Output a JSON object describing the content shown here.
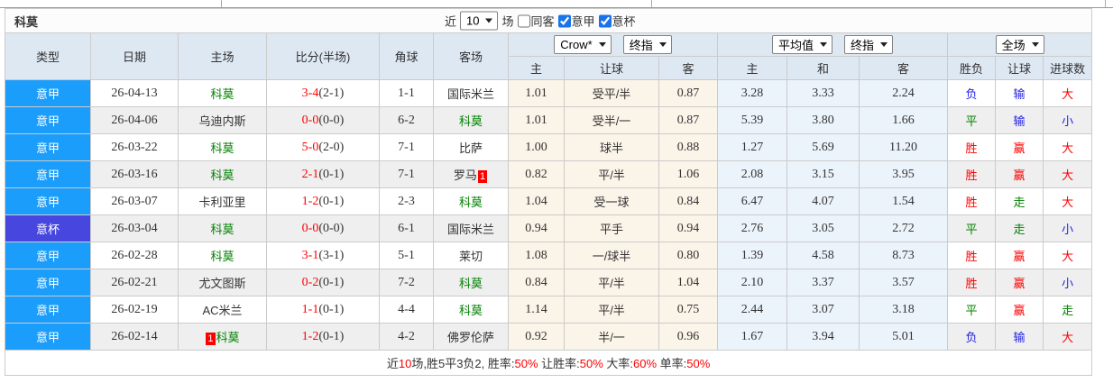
{
  "top": {
    "title": "科莫",
    "near_label": "近",
    "near_value": "10",
    "unit_label": "场",
    "checkboxes": [
      {
        "label": "同客",
        "checked": false
      },
      {
        "label": "意甲",
        "checked": true
      },
      {
        "label": "意杯",
        "checked": true
      }
    ]
  },
  "header": {
    "static": [
      "类型",
      "日期",
      "主场",
      "比分(半场)",
      "角球",
      "客场"
    ],
    "groups": [
      {
        "selects": [
          "Crow*",
          "终指"
        ],
        "sub": [
          "主",
          "让球",
          "客"
        ]
      },
      {
        "selects": [
          "平均值",
          "终指"
        ],
        "sub": [
          "主",
          "和",
          "客"
        ]
      },
      {
        "selects": [
          "全场"
        ],
        "sub": [
          "胜负",
          "让球",
          "进球数"
        ]
      }
    ]
  },
  "colors": {
    "serie_a_bg": "#1b9dfb",
    "coppa_bg": "#4747e0",
    "win_red": "#ff0000",
    "draw_green": "#008000",
    "lose_blue": "#2323e5",
    "como_green": "#008000"
  },
  "rows": [
    {
      "league": "意甲",
      "league_key": "seriea",
      "date": "26-04-13",
      "home": {
        "name": "科莫",
        "self": true
      },
      "score": "3-4",
      "half": "(2-1)",
      "corner": "1-1",
      "away": {
        "name": "国际米兰",
        "self": false
      },
      "crow": {
        "home": "1.01",
        "handicap": "受平/半",
        "away": "0.87"
      },
      "avg": {
        "home": "3.28",
        "draw": "3.33",
        "away": "2.24"
      },
      "full": {
        "wdl": {
          "t": "负",
          "c": "b"
        },
        "handicap": {
          "t": "输",
          "c": "b"
        },
        "goals": {
          "t": "大",
          "c": "r"
        }
      }
    },
    {
      "league": "意甲",
      "league_key": "seriea",
      "date": "26-04-06",
      "home": {
        "name": "乌迪内斯",
        "self": false
      },
      "score": "0-0",
      "half": "(0-0)",
      "corner": "6-2",
      "away": {
        "name": "科莫",
        "self": true
      },
      "crow": {
        "home": "1.01",
        "handicap": "受半/一",
        "away": "0.87"
      },
      "avg": {
        "home": "5.39",
        "draw": "3.80",
        "away": "1.66"
      },
      "full": {
        "wdl": {
          "t": "平",
          "c": "g"
        },
        "handicap": {
          "t": "输",
          "c": "b"
        },
        "goals": {
          "t": "小",
          "c": "b"
        }
      }
    },
    {
      "league": "意甲",
      "league_key": "seriea",
      "date": "26-03-22",
      "home": {
        "name": "科莫",
        "self": true
      },
      "score": "5-0",
      "half": "(2-0)",
      "corner": "7-1",
      "away": {
        "name": "比萨",
        "self": false
      },
      "crow": {
        "home": "1.00",
        "handicap": "球半",
        "away": "0.88"
      },
      "avg": {
        "home": "1.27",
        "draw": "5.69",
        "away": "11.20"
      },
      "full": {
        "wdl": {
          "t": "胜",
          "c": "r"
        },
        "handicap": {
          "t": "赢",
          "c": "r"
        },
        "goals": {
          "t": "大",
          "c": "r"
        }
      }
    },
    {
      "league": "意甲",
      "league_key": "seriea",
      "date": "26-03-16",
      "home": {
        "name": "科莫",
        "self": true
      },
      "score": "2-1",
      "half": "(0-1)",
      "corner": "7-1",
      "away": {
        "name": "罗马",
        "self": false,
        "badge": "1",
        "badge_pos": "after"
      },
      "crow": {
        "home": "0.82",
        "handicap": "平/半",
        "away": "1.06"
      },
      "avg": {
        "home": "2.08",
        "draw": "3.15",
        "away": "3.95"
      },
      "full": {
        "wdl": {
          "t": "胜",
          "c": "r"
        },
        "handicap": {
          "t": "赢",
          "c": "r"
        },
        "goals": {
          "t": "大",
          "c": "r"
        }
      }
    },
    {
      "league": "意甲",
      "league_key": "seriea",
      "date": "26-03-07",
      "home": {
        "name": "卡利亚里",
        "self": false
      },
      "score": "1-2",
      "half": "(0-1)",
      "corner": "2-3",
      "away": {
        "name": "科莫",
        "self": true
      },
      "crow": {
        "home": "1.04",
        "handicap": "受一球",
        "away": "0.84"
      },
      "avg": {
        "home": "6.47",
        "draw": "4.07",
        "away": "1.54"
      },
      "full": {
        "wdl": {
          "t": "胜",
          "c": "r"
        },
        "handicap": {
          "t": "走",
          "c": "g"
        },
        "goals": {
          "t": "大",
          "c": "r"
        }
      }
    },
    {
      "league": "意杯",
      "league_key": "coppa",
      "date": "26-03-04",
      "home": {
        "name": "科莫",
        "self": true
      },
      "score": "0-0",
      "half": "(0-0)",
      "corner": "6-1",
      "away": {
        "name": "国际米兰",
        "self": false
      },
      "crow": {
        "home": "0.94",
        "handicap": "平手",
        "away": "0.94"
      },
      "avg": {
        "home": "2.76",
        "draw": "3.05",
        "away": "2.72"
      },
      "full": {
        "wdl": {
          "t": "平",
          "c": "g"
        },
        "handicap": {
          "t": "走",
          "c": "g"
        },
        "goals": {
          "t": "小",
          "c": "b"
        }
      }
    },
    {
      "league": "意甲",
      "league_key": "seriea",
      "date": "26-02-28",
      "home": {
        "name": "科莫",
        "self": true
      },
      "score": "3-1",
      "half": "(3-1)",
      "corner": "5-1",
      "away": {
        "name": "莱切",
        "self": false
      },
      "crow": {
        "home": "1.08",
        "handicap": "一/球半",
        "away": "0.80"
      },
      "avg": {
        "home": "1.39",
        "draw": "4.58",
        "away": "8.73"
      },
      "full": {
        "wdl": {
          "t": "胜",
          "c": "r"
        },
        "handicap": {
          "t": "赢",
          "c": "r"
        },
        "goals": {
          "t": "大",
          "c": "r"
        }
      }
    },
    {
      "league": "意甲",
      "league_key": "seriea",
      "date": "26-02-21",
      "home": {
        "name": "尤文图斯",
        "self": false
      },
      "score": "0-2",
      "half": "(0-1)",
      "corner": "7-2",
      "away": {
        "name": "科莫",
        "self": true
      },
      "crow": {
        "home": "0.84",
        "handicap": "平/半",
        "away": "1.04"
      },
      "avg": {
        "home": "2.10",
        "draw": "3.37",
        "away": "3.57"
      },
      "full": {
        "wdl": {
          "t": "胜",
          "c": "r"
        },
        "handicap": {
          "t": "赢",
          "c": "r"
        },
        "goals": {
          "t": "小",
          "c": "b"
        }
      }
    },
    {
      "league": "意甲",
      "league_key": "seriea",
      "date": "26-02-19",
      "home": {
        "name": "AC米兰",
        "self": false
      },
      "score": "1-1",
      "half": "(0-1)",
      "corner": "4-4",
      "away": {
        "name": "科莫",
        "self": true
      },
      "crow": {
        "home": "1.14",
        "handicap": "平/半",
        "away": "0.75"
      },
      "avg": {
        "home": "2.44",
        "draw": "3.07",
        "away": "3.18"
      },
      "full": {
        "wdl": {
          "t": "平",
          "c": "g"
        },
        "handicap": {
          "t": "赢",
          "c": "r"
        },
        "goals": {
          "t": "走",
          "c": "g"
        }
      }
    },
    {
      "league": "意甲",
      "league_key": "seriea",
      "date": "26-02-14",
      "home": {
        "name": "科莫",
        "self": true,
        "badge": "1",
        "badge_pos": "before"
      },
      "score": "1-2",
      "half": "(0-1)",
      "corner": "4-2",
      "away": {
        "name": "佛罗伦萨",
        "self": false
      },
      "crow": {
        "home": "0.92",
        "handicap": "半/一",
        "away": "0.96"
      },
      "avg": {
        "home": "1.67",
        "draw": "3.94",
        "away": "5.01"
      },
      "full": {
        "wdl": {
          "t": "负",
          "c": "b"
        },
        "handicap": {
          "t": "输",
          "c": "b"
        },
        "goals": {
          "t": "大",
          "c": "r"
        }
      }
    }
  ],
  "footer": {
    "segments": [
      {
        "t": "近",
        "c": "k"
      },
      {
        "t": "10",
        "c": "r"
      },
      {
        "t": "场,胜5平3负2, 胜率:",
        "c": "k"
      },
      {
        "t": "50%",
        "c": "r"
      },
      {
        "t": " 让胜率:",
        "c": "k"
      },
      {
        "t": "50%",
        "c": "r"
      },
      {
        "t": " 大率:",
        "c": "k"
      },
      {
        "t": "60%",
        "c": "r"
      },
      {
        "t": " 单率:",
        "c": "k"
      },
      {
        "t": "50%",
        "c": "r"
      }
    ]
  }
}
